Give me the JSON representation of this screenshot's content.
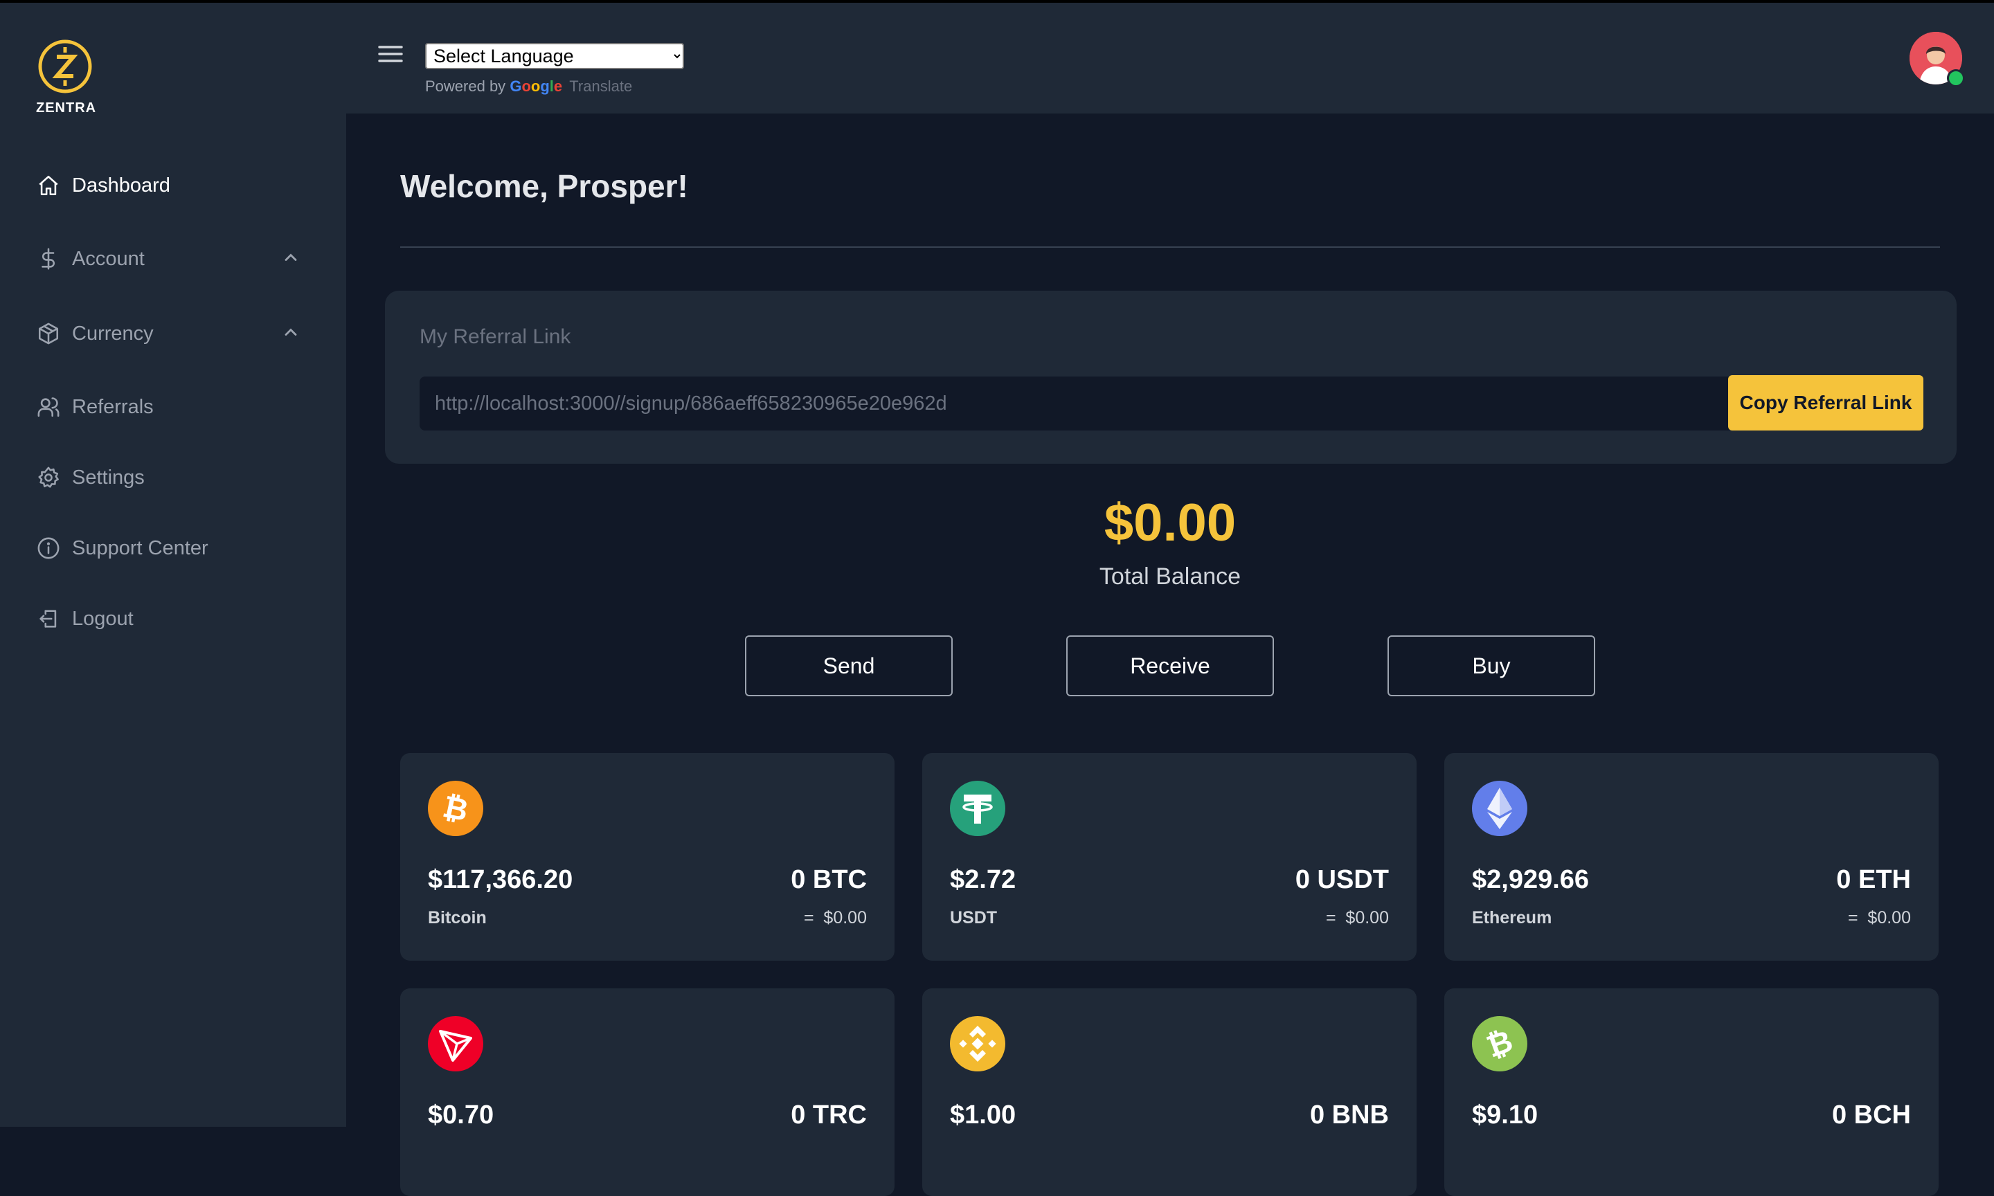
{
  "brand": {
    "name": "ZENTRA",
    "accent": "#f5c33b"
  },
  "sidebar": {
    "items": [
      {
        "label": "Dashboard",
        "icon": "home-icon",
        "active": true
      },
      {
        "label": "Account",
        "icon": "dollar-icon",
        "expandable": true
      },
      {
        "label": "Currency",
        "icon": "cube-icon",
        "expandable": true
      },
      {
        "label": "Referrals",
        "icon": "users-icon"
      },
      {
        "label": "Settings",
        "icon": "gear-icon"
      },
      {
        "label": "Support Center",
        "icon": "info-icon"
      },
      {
        "label": "Logout",
        "icon": "logout-icon"
      }
    ]
  },
  "topbar": {
    "language_select": "Select Language",
    "powered_by": "Powered by",
    "google": "Google",
    "translate": "Translate"
  },
  "main": {
    "welcome": "Welcome, Prosper!",
    "referral": {
      "title": "My Referral Link",
      "link": "http://localhost:3000//signup/686aeff658230965e20e962d",
      "copy_label": "Copy Referral Link"
    },
    "balance": {
      "amount": "$0.00",
      "label": "Total Balance"
    },
    "actions": {
      "send": "Send",
      "receive": "Receive",
      "buy": "Buy"
    },
    "coins": [
      {
        "price": "$117,366.20",
        "name": "Bitcoin",
        "amount": "0 BTC",
        "value": "=  $0.00",
        "icon": "bitcoin-icon",
        "color": "#f7931a"
      },
      {
        "price": "$2.72",
        "name": "USDT",
        "amount": "0 USDT",
        "value": "=  $0.00",
        "icon": "tether-icon",
        "color": "#26a17b"
      },
      {
        "price": "$2,929.66",
        "name": "Ethereum",
        "amount": "0 ETH",
        "value": "=  $0.00",
        "icon": "ethereum-icon",
        "color": "#627eea"
      },
      {
        "price": "$0.70",
        "name": "",
        "amount": "0 TRC",
        "value": "",
        "icon": "tron-icon",
        "color": "#ef0027"
      },
      {
        "price": "$1.00",
        "name": "",
        "amount": "0 BNB",
        "value": "",
        "icon": "bnb-icon",
        "color": "#f3ba2f"
      },
      {
        "price": "$9.10",
        "name": "",
        "amount": "0 BCH",
        "value": "",
        "icon": "bitcoin-cash-icon",
        "color": "#8dc351"
      }
    ]
  }
}
